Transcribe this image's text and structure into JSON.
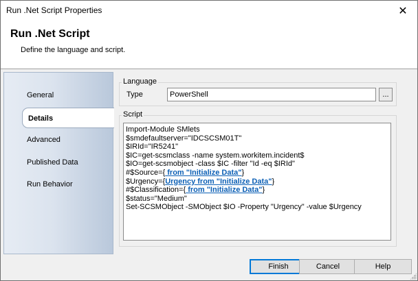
{
  "window": {
    "title": "Run .Net Script Properties",
    "close_glyph": "✕"
  },
  "header": {
    "title": "Run .Net Script",
    "subtitle": "Define the language and script."
  },
  "nav": {
    "items": [
      {
        "label": "General",
        "selected": false
      },
      {
        "label": "Details",
        "selected": true
      },
      {
        "label": "Advanced",
        "selected": false
      },
      {
        "label": "Published Data",
        "selected": false
      },
      {
        "label": "Run Behavior",
        "selected": false
      }
    ]
  },
  "language": {
    "group_label": "Language",
    "type_label": "Type",
    "type_value": "PowerShell",
    "browse_label": "..."
  },
  "script": {
    "group_label": "Script",
    "lines": [
      [
        {
          "text": "Import-Module SMlets"
        }
      ],
      [
        {
          "text": "$smdefaultserver=\"IDCSCSM01T\""
        }
      ],
      [
        {
          "text": "$IRId=\"IR5241\""
        }
      ],
      [
        {
          "text": "$IC=get-scsmclass -name system.workitem.incident$"
        }
      ],
      [
        {
          "text": "$IO=get-scsmobject -class $IC -filter \"Id -eq $IRId\""
        }
      ],
      [
        {
          "text": "#$Source={"
        },
        {
          "text": " from \"Initialize Data\"",
          "token": true
        },
        {
          "text": "}"
        }
      ],
      [
        {
          "text": "$Urgency={"
        },
        {
          "text": "Urgency from \"Initialize Data\"",
          "token": true
        },
        {
          "text": "}"
        }
      ],
      [
        {
          "text": "#$Classification={"
        },
        {
          "text": " from \"Initialize Data\"",
          "token": true
        },
        {
          "text": "}"
        }
      ],
      [
        {
          "text": "$status=\"Medium\""
        }
      ],
      [
        {
          "text": "Set-SCSMObject -SMObject $IO -Property \"Urgency\" -value $Urgency"
        }
      ]
    ],
    "token_color": "#0b5fb5"
  },
  "footer": {
    "finish_label": "Finish",
    "cancel_label": "Cancel",
    "help_label": "Help"
  }
}
